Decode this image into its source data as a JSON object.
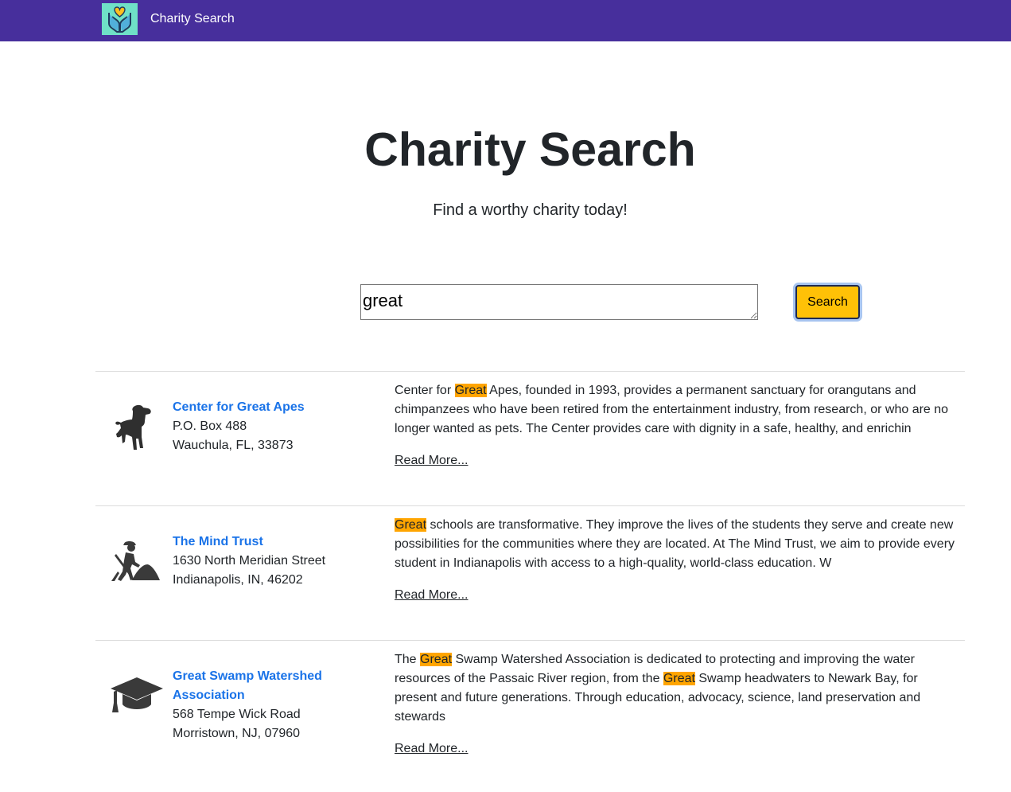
{
  "navbar": {
    "brand": "Charity Search",
    "logo_icon": "hands-heart-icon",
    "background": "#472f9c"
  },
  "hero": {
    "title": "Charity Search",
    "subtitle": "Find a worthy charity today!"
  },
  "search": {
    "value": "great",
    "button_label": "Search",
    "button_color": "#ffc107"
  },
  "highlight_color": "#ffa500",
  "results": [
    {
      "icon": "dog-icon",
      "name": "Center for Great Apes",
      "address_line1": "P.O. Box 488",
      "address_line2": "Wauchula, FL, 33873",
      "description_parts": [
        "Center for ",
        "Great",
        " Apes, founded in 1993, provides a permanent sanctuary for orangutans and chimpanzees who have been retired from the entertainment industry, from research, or who are no longer wanted as pets. The Center provides care with dignity in a safe, healthy, and enrichin"
      ],
      "read_more": "Read More..."
    },
    {
      "icon": "construction-worker-icon",
      "name": "The Mind Trust",
      "address_line1": "1630 North Meridian Street",
      "address_line2": "Indianapolis, IN, 46202",
      "description_parts": [
        "",
        "Great",
        " schools are transformative. They improve the lives of the students they serve and create new possibilities for the communities where they are located. At The Mind Trust, we aim to provide every student in Indianapolis with access to a high-quality, world-class education. W"
      ],
      "read_more": "Read More..."
    },
    {
      "icon": "graduation-cap-icon",
      "name": "Great Swamp Watershed Association",
      "address_line1": "568 Tempe Wick Road",
      "address_line2": "Morristown, NJ, 07960",
      "description_parts": [
        "The ",
        "Great",
        " Swamp Watershed Association is dedicated to protecting and improving the water resources of the Passaic River region, from the ",
        "Great",
        " Swamp headwaters to Newark Bay, for present and future generations. Through education, advocacy, science, land preservation and stewards"
      ],
      "read_more": "Read More..."
    }
  ]
}
